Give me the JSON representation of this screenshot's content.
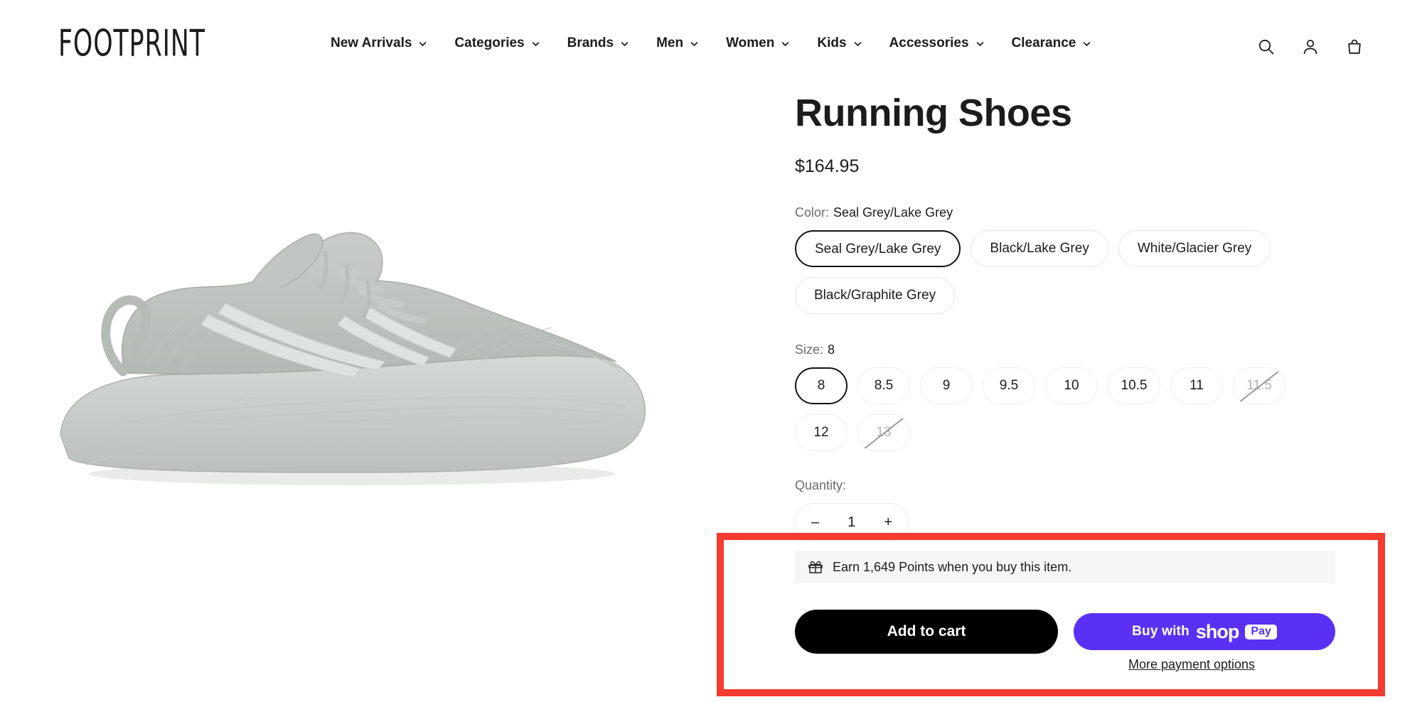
{
  "header": {
    "logo": "FOOTPRINT",
    "nav": [
      {
        "label": "New Arrivals",
        "has_dropdown": true
      },
      {
        "label": "Categories",
        "has_dropdown": true
      },
      {
        "label": "Brands",
        "has_dropdown": true
      },
      {
        "label": "Men",
        "has_dropdown": true
      },
      {
        "label": "Women",
        "has_dropdown": true
      },
      {
        "label": "Kids",
        "has_dropdown": true
      },
      {
        "label": "Accessories",
        "has_dropdown": true
      },
      {
        "label": "Clearance",
        "has_dropdown": true
      }
    ],
    "icons": [
      "search-icon",
      "account-icon",
      "cart-icon"
    ]
  },
  "product": {
    "title": "Running Shoes",
    "price": "$164.95",
    "image_alt": "grey running shoe side view",
    "color": {
      "label": "Color:",
      "selected": "Seal Grey/Lake Grey",
      "options": [
        {
          "label": "Seal Grey/Lake Grey",
          "selected": true
        },
        {
          "label": "Black/Lake Grey",
          "selected": false
        },
        {
          "label": "White/Glacier Grey",
          "selected": false
        },
        {
          "label": "Black/Graphite Grey",
          "selected": false
        }
      ]
    },
    "size": {
      "label": "Size:",
      "selected": "8",
      "options": [
        {
          "label": "8",
          "selected": true,
          "available": true
        },
        {
          "label": "8.5",
          "selected": false,
          "available": true
        },
        {
          "label": "9",
          "selected": false,
          "available": true
        },
        {
          "label": "9.5",
          "selected": false,
          "available": true
        },
        {
          "label": "10",
          "selected": false,
          "available": true
        },
        {
          "label": "10.5",
          "selected": false,
          "available": true
        },
        {
          "label": "11",
          "selected": false,
          "available": true
        },
        {
          "label": "11.5",
          "selected": false,
          "available": false
        },
        {
          "label": "12",
          "selected": false,
          "available": true
        },
        {
          "label": "13",
          "selected": false,
          "available": false
        }
      ]
    },
    "quantity": {
      "label": "Quantity:",
      "value": "1",
      "decrease": "–",
      "increase": "+"
    }
  },
  "purchase": {
    "points_text": "Earn 1,649 Points when you buy this item.",
    "points_icon": "gift-icon",
    "add_to_cart": "Add to cart",
    "shop_pay": {
      "prefix": "Buy with",
      "brand": "shop",
      "badge": "Pay"
    },
    "more_payment_options": "More payment options"
  },
  "annotation": {
    "color": "#f53a30",
    "target": "purchase-section"
  }
}
